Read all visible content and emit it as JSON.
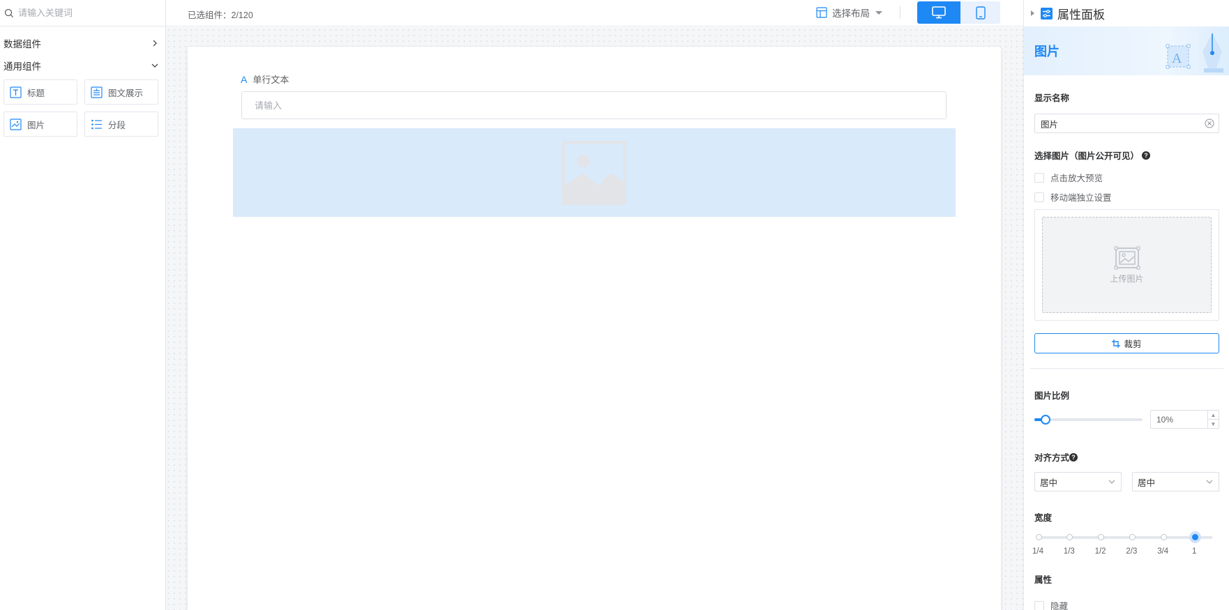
{
  "left": {
    "search_placeholder": "请输入关键词",
    "groups": [
      {
        "label": "数据组件",
        "icon": "chevron-right-icon"
      },
      {
        "label": "通用组件",
        "icon": "chevron-down-icon"
      }
    ],
    "components": [
      {
        "label": "标题",
        "icon": "title-icon"
      },
      {
        "label": "图文展示",
        "icon": "image-text-icon"
      },
      {
        "label": "图片",
        "icon": "image-icon"
      },
      {
        "label": "分段",
        "icon": "list-icon"
      }
    ]
  },
  "topbar": {
    "selected_count": "已选组件：2/120",
    "layout_label": "选择布局",
    "devices": [
      {
        "name": "desktop",
        "icon": "desktop-icon",
        "active": true
      },
      {
        "name": "mobile",
        "icon": "mobile-icon",
        "active": false
      }
    ]
  },
  "canvas": {
    "field_label": "单行文本",
    "field_placeholder": "请输入"
  },
  "properties": {
    "header": "属性面板",
    "title": "图片",
    "display_name_label": "显示名称",
    "display_name_value": "图片",
    "select_image_label": "选择图片（图片公开可见）",
    "checkbox_preview": "点击放大预览",
    "checkbox_mobile": "移动端独立设置",
    "upload_text": "上传图片",
    "crop_label": "裁剪",
    "ratio_label": "图片比例",
    "ratio_value": "10%",
    "align_label": "对齐方式",
    "align_h": "居中",
    "align_v": "居中",
    "width_label": "宽度",
    "width_stops": [
      "1/4",
      "1/3",
      "1/2",
      "2/3",
      "3/4",
      "1"
    ],
    "width_selected": "1",
    "attr_label": "属性",
    "hide_label": "隐藏"
  },
  "colors": {
    "accent": "#1e88f5",
    "image_placeholder_bg": "#d9eafb"
  }
}
